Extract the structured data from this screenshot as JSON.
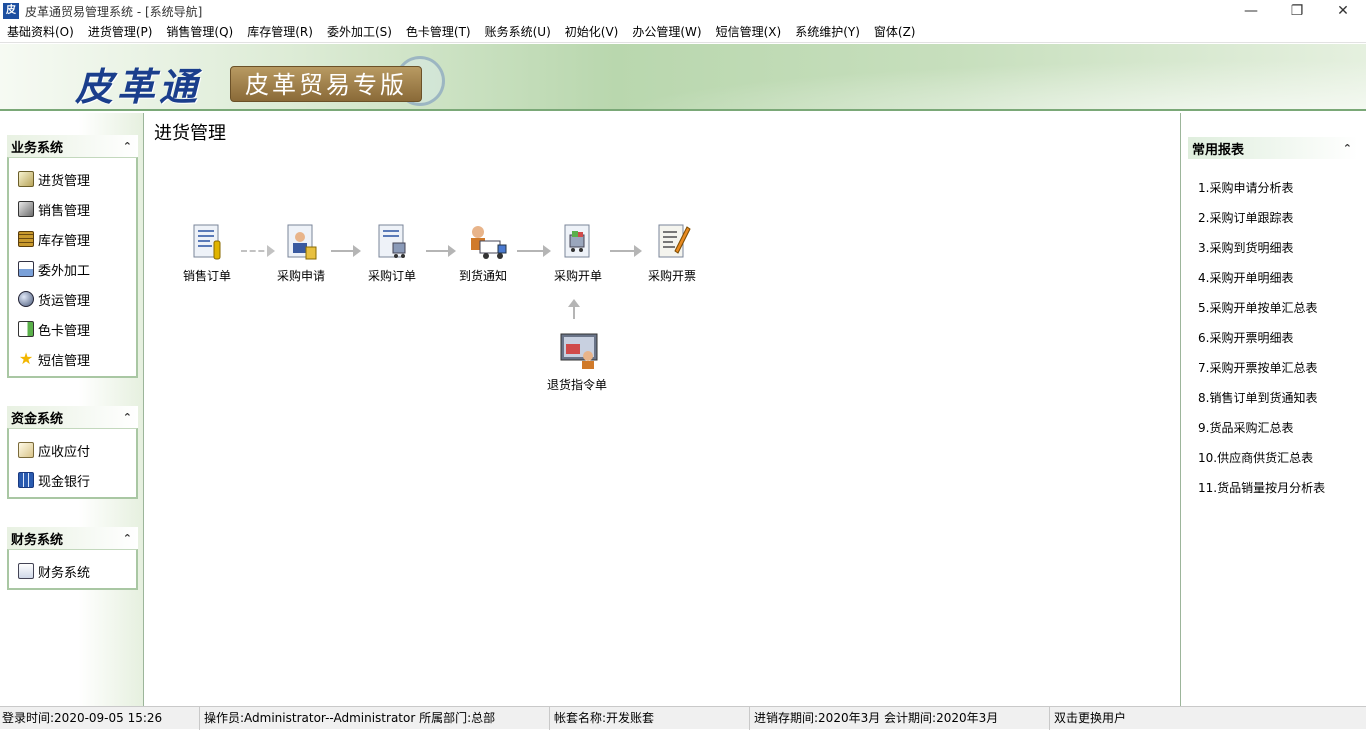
{
  "window": {
    "title": "皮革通贸易管理系统 - [系统导航]",
    "icon_text": "皮",
    "minimize_glyph": "—",
    "restore_glyph": "❐",
    "close_glyph": "✕"
  },
  "menu": [
    "基础资料(O)",
    "进货管理(P)",
    "销售管理(Q)",
    "库存管理(R)",
    "委外加工(S)",
    "色卡管理(T)",
    "账务系统(U)",
    "初始化(V)",
    "办公管理(W)",
    "短信管理(X)",
    "系统维护(Y)",
    "窗体(Z)"
  ],
  "banner": {
    "logo": "皮革通",
    "subtitle": "皮革贸易专版"
  },
  "sidebar": {
    "collapse_glyph": "⌃",
    "groups": [
      {
        "title": "业务系统",
        "items": [
          {
            "label": "进货管理",
            "icon": "purchase-icon"
          },
          {
            "label": "销售管理",
            "icon": "sales-icon"
          },
          {
            "label": "库存管理",
            "icon": "inventory-icon"
          },
          {
            "label": "委外加工",
            "icon": "outsource-icon"
          },
          {
            "label": "货运管理",
            "icon": "shipping-icon"
          },
          {
            "label": "色卡管理",
            "icon": "color-card-icon"
          },
          {
            "label": "短信管理",
            "icon": "star-icon"
          }
        ]
      },
      {
        "title": "资金系统",
        "items": [
          {
            "label": "应收应付",
            "icon": "receivable-icon"
          },
          {
            "label": "现金银行",
            "icon": "cash-bank-icon"
          }
        ]
      },
      {
        "title": "财务系统",
        "items": [
          {
            "label": "财务系统",
            "icon": "finance-icon"
          }
        ]
      }
    ]
  },
  "main": {
    "title": "进货管理",
    "flow": [
      {
        "label": "销售订单",
        "icon": "sales-order-icon"
      },
      {
        "label": "采购申请",
        "icon": "purchase-request-icon"
      },
      {
        "label": "采购订单",
        "icon": "purchase-order-icon"
      },
      {
        "label": "到货通知",
        "icon": "arrival-notice-icon"
      },
      {
        "label": "采购开单",
        "icon": "purchase-bill-icon"
      },
      {
        "label": "采购开票",
        "icon": "purchase-invoice-icon"
      },
      {
        "label": "退货指令单",
        "icon": "return-order-icon"
      }
    ]
  },
  "reports": {
    "title": "常用报表",
    "items": [
      "1.采购申请分析表",
      "2.采购订单跟踪表",
      "3.采购到货明细表",
      "4.采购开单明细表",
      "5.采购开单按单汇总表",
      "6.采购开票明细表",
      "7.采购开票按单汇总表",
      "8.销售订单到货通知表",
      "9.货品采购汇总表",
      "10.供应商供货汇总表",
      "11.货品销量按月分析表"
    ]
  },
  "status": {
    "login_time": "登录时间:2020-09-05 15:26",
    "operator": "操作员:Administrator--Administrator 所属部门:总部",
    "account": "帐套名称:开发账套",
    "period": "进销存期间:2020年3月  会计期间:2020年3月",
    "switch_user": "双击更换用户"
  }
}
